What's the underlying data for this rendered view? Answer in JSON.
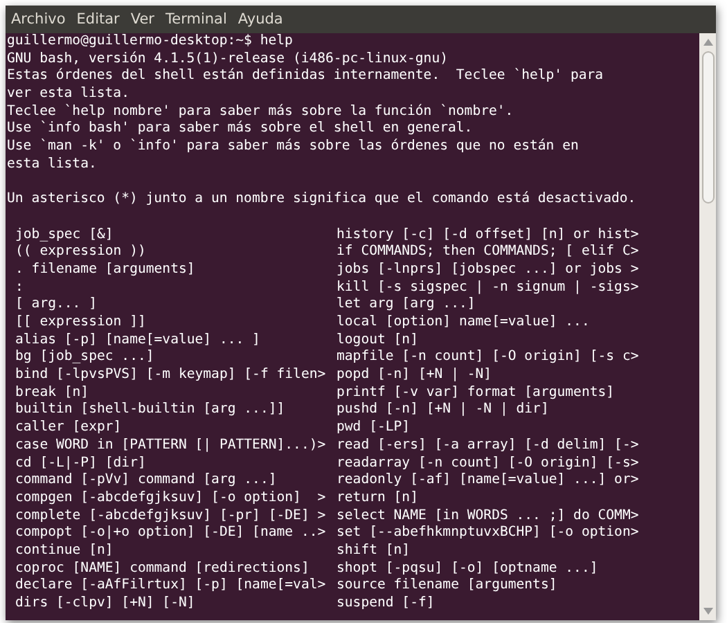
{
  "menu": [
    "Archivo",
    "Editar",
    "Ver",
    "Terminal",
    "Ayuda"
  ],
  "terminal": {
    "prompt": "guillermo@guillermo-desktop:~$ help",
    "intro_lines": [
      "GNU bash, versión 4.1.5(1)-release (i486-pc-linux-gnu)",
      "Estas órdenes del shell están definidas internamente.  Teclee `help' para",
      "ver esta lista.",
      "Teclee `help nombre' para saber más sobre la función `nombre'.",
      "Use `info bash' para saber más sobre el shell en general.",
      "Use `man -k' o `info' para saber más sobre las órdenes que no están en",
      "esta lista."
    ],
    "notice": "Un asterisco (*) junto a un nombre significa que el comando está desactivado.",
    "commands": [
      {
        "left": "job_spec [&]",
        "right": "history [-c] [-d offset] [n] or hist>"
      },
      {
        "left": "(( expression ))",
        "right": "if COMMANDS; then COMMANDS; [ elif C>"
      },
      {
        "left": ". filename [arguments]",
        "right": "jobs [-lnprs] [jobspec ...] or jobs >"
      },
      {
        "left": ":",
        "right": "kill [-s sigspec | -n signum | -sigs>"
      },
      {
        "left": "[ arg... ]",
        "right": "let arg [arg ...]"
      },
      {
        "left": "[[ expression ]]",
        "right": "local [option] name[=value] ..."
      },
      {
        "left": "alias [-p] [name[=value] ... ]",
        "right": "logout [n]"
      },
      {
        "left": "bg [job_spec ...]",
        "right": "mapfile [-n count] [-O origin] [-s c>"
      },
      {
        "left": "bind [-lpvsPVS] [-m keymap] [-f filen>",
        "right": "popd [-n] [+N | -N]"
      },
      {
        "left": "break [n]",
        "right": "printf [-v var] format [arguments]"
      },
      {
        "left": "builtin [shell-builtin [arg ...]]",
        "right": "pushd [-n] [+N | -N | dir]"
      },
      {
        "left": "caller [expr]",
        "right": "pwd [-LP]"
      },
      {
        "left": "case WORD in [PATTERN [| PATTERN]...)>",
        "right": "read [-ers] [-a array] [-d delim] [->"
      },
      {
        "left": "cd [-L|-P] [dir]",
        "right": "readarray [-n count] [-O origin] [-s>"
      },
      {
        "left": "command [-pVv] command [arg ...]",
        "right": "readonly [-af] [name[=value] ...] or>"
      },
      {
        "left": "compgen [-abcdefgjksuv] [-o option]  >",
        "right": "return [n]"
      },
      {
        "left": "complete [-abcdefgjksuv] [-pr] [-DE] >",
        "right": "select NAME [in WORDS ... ;] do COMM>"
      },
      {
        "left": "compopt [-o|+o option] [-DE] [name ..>",
        "right": "set [--abefhkmnptuvxBCHP] [-o option>"
      },
      {
        "left": "continue [n]",
        "right": "shift [n]"
      },
      {
        "left": "coproc [NAME] command [redirections]",
        "right": "shopt [-pqsu] [-o] [optname ...]"
      },
      {
        "left": "declare [-aAfFilrtux] [-p] [name[=val>",
        "right": "source filename [arguments]"
      },
      {
        "left": "dirs [-clpv] [+N] [-N]",
        "right": "suspend [-f]"
      }
    ]
  }
}
